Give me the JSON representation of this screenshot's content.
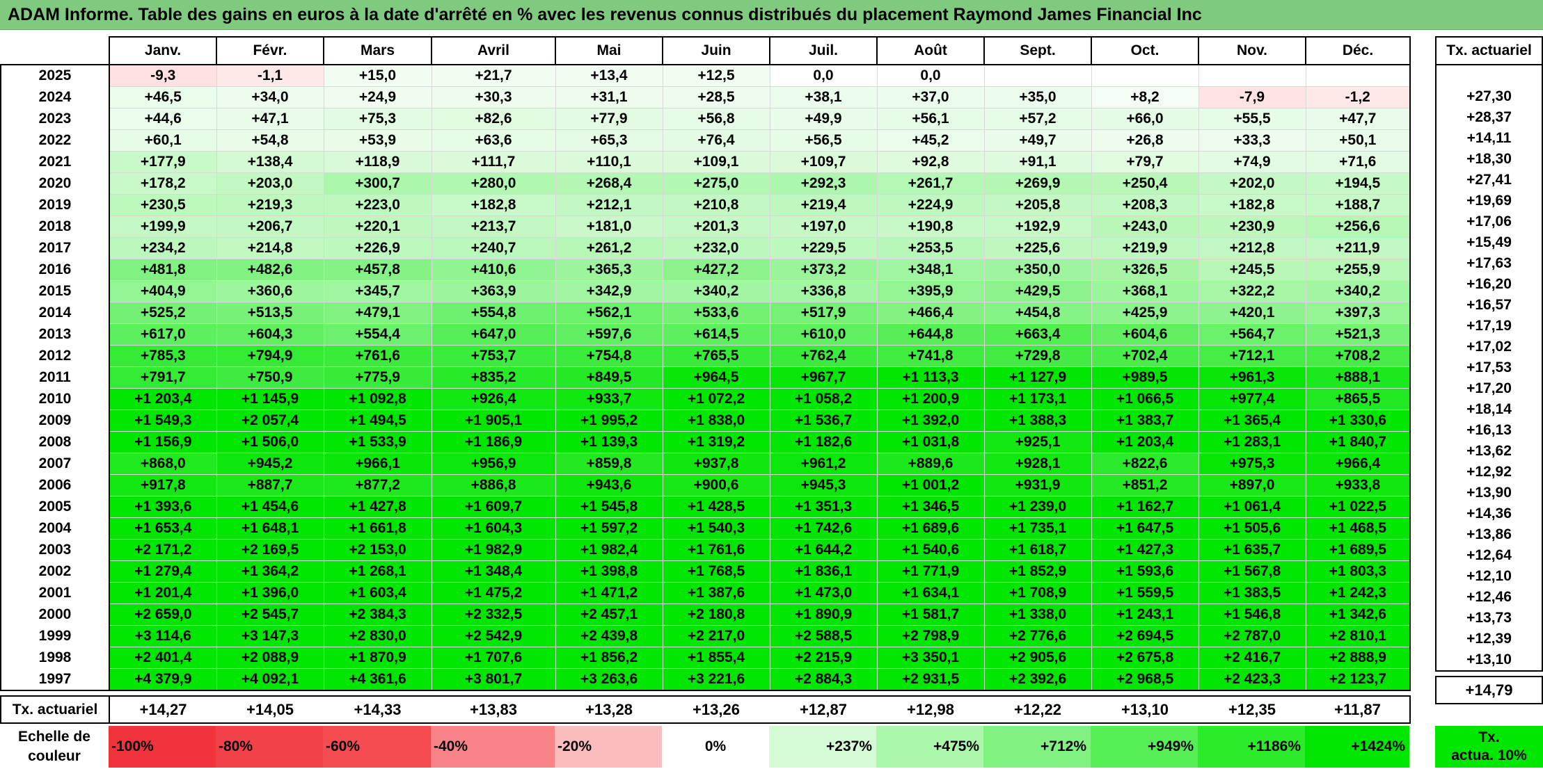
{
  "title": "ADAM Informe. Table des gains en euros à la date d'arrêté en % avec les revenus connus distribués du placement Raymond James Financial Inc",
  "months": [
    "Janv.",
    "Févr.",
    "Mars",
    "Avril",
    "Mai",
    "Juin",
    "Juil.",
    "Août",
    "Sept.",
    "Oct.",
    "Nov.",
    "Déc."
  ],
  "side_header": "Tx. actuariel",
  "rows": [
    {
      "year": "2025",
      "values": [
        "-9,3",
        "-1,1",
        "+15,0",
        "+21,7",
        "+13,4",
        "+12,5",
        "0,0",
        "0,0",
        "",
        "",
        "",
        ""
      ],
      "rate": ""
    },
    {
      "year": "2024",
      "values": [
        "+46,5",
        "+34,0",
        "+24,9",
        "+30,3",
        "+31,1",
        "+28,5",
        "+38,1",
        "+37,0",
        "+35,0",
        "+8,2",
        "-7,9",
        "-1,2"
      ],
      "rate": "+27,30"
    },
    {
      "year": "2023",
      "values": [
        "+44,6",
        "+47,1",
        "+75,3",
        "+82,6",
        "+77,9",
        "+56,8",
        "+49,9",
        "+56,1",
        "+57,2",
        "+66,0",
        "+55,5",
        "+47,7"
      ],
      "rate": "+28,37"
    },
    {
      "year": "2022",
      "values": [
        "+60,1",
        "+54,8",
        "+53,9",
        "+63,6",
        "+65,3",
        "+76,4",
        "+56,5",
        "+45,2",
        "+49,7",
        "+26,8",
        "+33,3",
        "+50,1"
      ],
      "rate": "+14,11"
    },
    {
      "year": "2021",
      "values": [
        "+177,9",
        "+138,4",
        "+118,9",
        "+111,7",
        "+110,1",
        "+109,1",
        "+109,7",
        "+92,8",
        "+91,1",
        "+79,7",
        "+74,9",
        "+71,6"
      ],
      "rate": "+18,30"
    },
    {
      "year": "2020",
      "values": [
        "+178,2",
        "+203,0",
        "+300,7",
        "+280,0",
        "+268,4",
        "+275,0",
        "+292,3",
        "+261,7",
        "+269,9",
        "+250,4",
        "+202,0",
        "+194,5"
      ],
      "rate": "+27,41"
    },
    {
      "year": "2019",
      "values": [
        "+230,5",
        "+219,3",
        "+223,0",
        "+182,8",
        "+212,1",
        "+210,8",
        "+219,4",
        "+224,9",
        "+205,8",
        "+208,3",
        "+182,8",
        "+188,7"
      ],
      "rate": "+19,69"
    },
    {
      "year": "2018",
      "values": [
        "+199,9",
        "+206,7",
        "+220,1",
        "+213,7",
        "+181,0",
        "+201,3",
        "+197,0",
        "+190,8",
        "+192,9",
        "+243,0",
        "+230,9",
        "+256,6"
      ],
      "rate": "+17,06"
    },
    {
      "year": "2017",
      "values": [
        "+234,2",
        "+214,8",
        "+226,9",
        "+240,7",
        "+261,2",
        "+232,0",
        "+229,5",
        "+253,5",
        "+225,6",
        "+219,9",
        "+212,8",
        "+211,9"
      ],
      "rate": "+15,49"
    },
    {
      "year": "2016",
      "values": [
        "+481,8",
        "+482,6",
        "+457,8",
        "+410,6",
        "+365,3",
        "+427,2",
        "+373,2",
        "+348,1",
        "+350,0",
        "+326,5",
        "+245,5",
        "+255,9"
      ],
      "rate": "+17,63"
    },
    {
      "year": "2015",
      "values": [
        "+404,9",
        "+360,6",
        "+345,7",
        "+363,9",
        "+342,9",
        "+340,2",
        "+336,8",
        "+395,9",
        "+429,5",
        "+368,1",
        "+322,2",
        "+340,2"
      ],
      "rate": "+16,20"
    },
    {
      "year": "2014",
      "values": [
        "+525,2",
        "+513,5",
        "+479,1",
        "+554,8",
        "+562,1",
        "+533,6",
        "+517,9",
        "+466,4",
        "+454,8",
        "+425,9",
        "+420,1",
        "+397,3"
      ],
      "rate": "+16,57"
    },
    {
      "year": "2013",
      "values": [
        "+617,0",
        "+604,3",
        "+554,4",
        "+647,0",
        "+597,6",
        "+614,5",
        "+610,0",
        "+644,8",
        "+663,4",
        "+604,6",
        "+564,7",
        "+521,3"
      ],
      "rate": "+17,19"
    },
    {
      "year": "2012",
      "values": [
        "+785,3",
        "+794,9",
        "+761,6",
        "+753,7",
        "+754,8",
        "+765,5",
        "+762,4",
        "+741,8",
        "+729,8",
        "+702,4",
        "+712,1",
        "+708,2"
      ],
      "rate": "+17,02"
    },
    {
      "year": "2011",
      "values": [
        "+791,7",
        "+750,9",
        "+775,9",
        "+835,2",
        "+849,5",
        "+964,5",
        "+967,7",
        "+1 113,3",
        "+1 127,9",
        "+989,5",
        "+961,3",
        "+888,1"
      ],
      "rate": "+17,53"
    },
    {
      "year": "2010",
      "values": [
        "+1 203,4",
        "+1 145,9",
        "+1 092,8",
        "+926,4",
        "+933,7",
        "+1 072,2",
        "+1 058,2",
        "+1 200,9",
        "+1 173,1",
        "+1 066,5",
        "+977,4",
        "+865,5"
      ],
      "rate": "+17,20"
    },
    {
      "year": "2009",
      "values": [
        "+1 549,3",
        "+2 057,4",
        "+1 494,5",
        "+1 905,1",
        "+1 995,2",
        "+1 838,0",
        "+1 536,7",
        "+1 392,0",
        "+1 388,3",
        "+1 383,7",
        "+1 365,4",
        "+1 330,6"
      ],
      "rate": "+18,14"
    },
    {
      "year": "2008",
      "values": [
        "+1 156,9",
        "+1 506,0",
        "+1 533,9",
        "+1 186,9",
        "+1 139,3",
        "+1 319,2",
        "+1 182,6",
        "+1 031,8",
        "+925,1",
        "+1 203,4",
        "+1 283,1",
        "+1 840,7"
      ],
      "rate": "+16,13"
    },
    {
      "year": "2007",
      "values": [
        "+868,0",
        "+945,2",
        "+966,1",
        "+956,9",
        "+859,8",
        "+937,8",
        "+961,2",
        "+889,6",
        "+928,1",
        "+822,6",
        "+975,3",
        "+966,4"
      ],
      "rate": "+13,62"
    },
    {
      "year": "2006",
      "values": [
        "+917,8",
        "+887,7",
        "+877,2",
        "+886,8",
        "+943,6",
        "+900,6",
        "+945,3",
        "+1 001,2",
        "+931,9",
        "+851,2",
        "+897,0",
        "+933,8"
      ],
      "rate": "+12,92"
    },
    {
      "year": "2005",
      "values": [
        "+1 393,6",
        "+1 454,6",
        "+1 427,8",
        "+1 609,7",
        "+1 545,8",
        "+1 428,5",
        "+1 351,3",
        "+1 346,5",
        "+1 239,0",
        "+1 162,7",
        "+1 061,4",
        "+1 022,5"
      ],
      "rate": "+13,90"
    },
    {
      "year": "2004",
      "values": [
        "+1 653,4",
        "+1 648,1",
        "+1 661,8",
        "+1 604,3",
        "+1 597,2",
        "+1 540,3",
        "+1 742,6",
        "+1 689,6",
        "+1 735,1",
        "+1 647,5",
        "+1 505,6",
        "+1 468,5"
      ],
      "rate": "+14,36"
    },
    {
      "year": "2003",
      "values": [
        "+2 171,2",
        "+2 169,5",
        "+2 153,0",
        "+1 982,9",
        "+1 982,4",
        "+1 761,6",
        "+1 644,2",
        "+1 540,6",
        "+1 618,7",
        "+1 427,3",
        "+1 635,7",
        "+1 689,5"
      ],
      "rate": "+13,86"
    },
    {
      "year": "2002",
      "values": [
        "+1 279,4",
        "+1 364,2",
        "+1 268,1",
        "+1 348,4",
        "+1 398,8",
        "+1 768,5",
        "+1 836,1",
        "+1 771,9",
        "+1 852,9",
        "+1 593,6",
        "+1 567,8",
        "+1 803,3"
      ],
      "rate": "+12,64"
    },
    {
      "year": "2001",
      "values": [
        "+1 201,4",
        "+1 396,0",
        "+1 603,4",
        "+1 475,2",
        "+1 471,2",
        "+1 387,6",
        "+1 473,0",
        "+1 634,1",
        "+1 708,9",
        "+1 559,5",
        "+1 383,5",
        "+1 242,3"
      ],
      "rate": "+12,10"
    },
    {
      "year": "2000",
      "values": [
        "+2 659,0",
        "+2 545,7",
        "+2 384,3",
        "+2 332,5",
        "+2 457,1",
        "+2 180,8",
        "+1 890,9",
        "+1 581,7",
        "+1 338,0",
        "+1 243,1",
        "+1 546,8",
        "+1 342,6"
      ],
      "rate": "+12,46"
    },
    {
      "year": "1999",
      "values": [
        "+3 114,6",
        "+3 147,3",
        "+2 830,0",
        "+2 542,9",
        "+2 439,8",
        "+2 217,0",
        "+2 588,5",
        "+2 798,9",
        "+2 776,6",
        "+2 694,5",
        "+2 787,0",
        "+2 810,1"
      ],
      "rate": "+13,73"
    },
    {
      "year": "1998",
      "values": [
        "+2 401,4",
        "+2 088,9",
        "+1 870,9",
        "+1 707,6",
        "+1 856,2",
        "+1 855,4",
        "+2 215,9",
        "+3 350,1",
        "+2 905,6",
        "+2 675,8",
        "+2 416,7",
        "+2 888,9"
      ],
      "rate": "+12,39"
    },
    {
      "year": "1997",
      "values": [
        "+4 379,9",
        "+4 092,1",
        "+4 361,6",
        "+3 801,7",
        "+3 263,6",
        "+3 221,6",
        "+2 884,3",
        "+2 931,5",
        "+2 392,6",
        "+2 968,5",
        "+2 423,3",
        "+2 123,7"
      ],
      "rate": "+13,10"
    }
  ],
  "totals": {
    "label": "Tx. actuariel",
    "values": [
      "+14,27",
      "+14,05",
      "+14,33",
      "+13,83",
      "+13,28",
      "+13,26",
      "+12,87",
      "+12,98",
      "+12,22",
      "+13,10",
      "+12,35",
      "+11,87"
    ],
    "overall": "+14,79"
  },
  "legend": {
    "label": "Echelle de couleur",
    "label_line1": "Echelle de",
    "label_line2": "couleur",
    "scale": [
      {
        "label": "-100%",
        "color": "#f1343b"
      },
      {
        "label": "-80%",
        "color": "#f34149"
      },
      {
        "label": "-60%",
        "color": "#f54c52"
      },
      {
        "label": "-40%",
        "color": "#f88488"
      },
      {
        "label": "-20%",
        "color": "#fbbcbd"
      },
      {
        "label": "0%",
        "color": "#ffffff"
      },
      {
        "label": "+237%",
        "color": "#d5fbd5"
      },
      {
        "label": "+475%",
        "color": "#abf7ab"
      },
      {
        "label": "+712%",
        "color": "#80f280"
      },
      {
        "label": "+949%",
        "color": "#55ee55"
      },
      {
        "label": "+1186%",
        "color": "#2beb2b"
      },
      {
        "label": "+1424%",
        "color": "#00e600"
      }
    ],
    "target_line1": "Tx.",
    "target_line2": "actua. 10%",
    "target_color": "#00e600"
  }
}
